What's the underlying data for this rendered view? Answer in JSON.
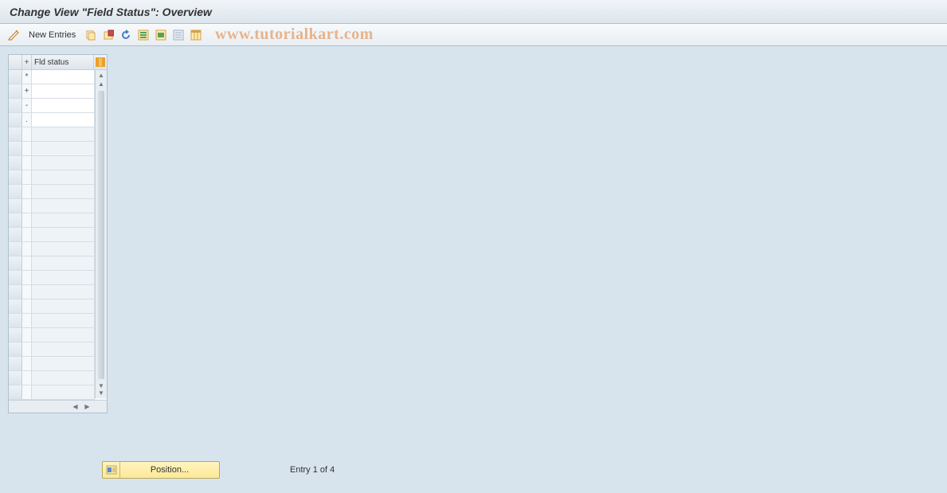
{
  "header": {
    "title": "Change View \"Field Status\": Overview"
  },
  "toolbar": {
    "new_entries_label": "New Entries"
  },
  "watermark": "www.tutorialkart.com",
  "table": {
    "header": {
      "plus": "+",
      "fld_status": "Fld status"
    },
    "rows": [
      {
        "marker": "*",
        "value": ""
      },
      {
        "marker": "+",
        "value": ""
      },
      {
        "marker": "-",
        "value": ""
      },
      {
        "marker": ".",
        "value": ""
      }
    ],
    "empty_row_count": 19
  },
  "footer": {
    "position_label": "Position...",
    "entry_status": "Entry 1 of 4"
  }
}
